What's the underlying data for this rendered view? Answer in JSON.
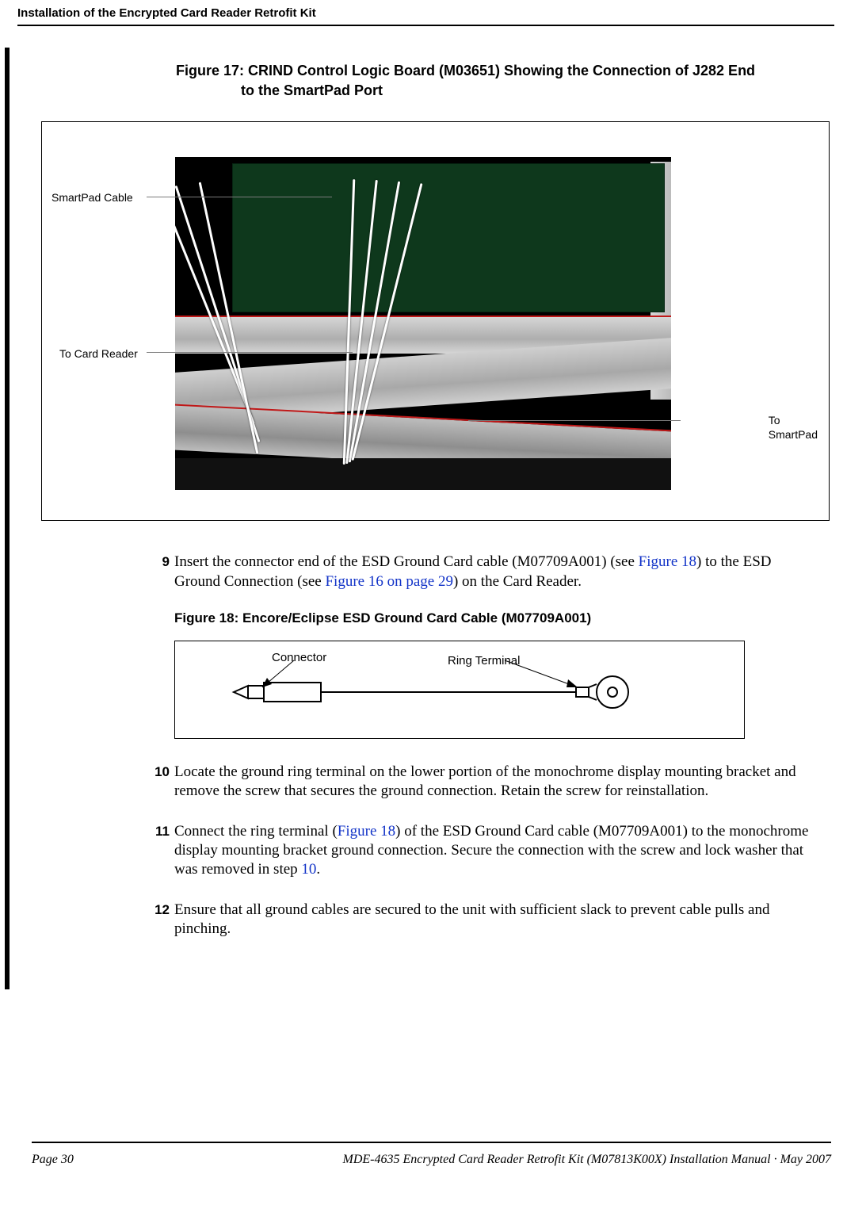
{
  "header": {
    "section_title": "Installation of the Encrypted Card Reader Retrofit Kit"
  },
  "figure17": {
    "caption_line1": "Figure 17: CRIND Control Logic Board (M03651) Showing the Connection of J282 End",
    "caption_line2": "to the SmartPad Port",
    "label_smartpad_cable": "SmartPad Cable",
    "label_to_card_reader": "To Card Reader",
    "label_to_smartpad_1": "To",
    "label_to_smartpad_2": "SmartPad"
  },
  "steps": {
    "s9": {
      "num": "9",
      "pre": "Insert the connector end of the ESD Ground Card cable (M07709A001) (see ",
      "link9a": "Figure 18",
      "mid": ") to the ESD Ground Connection (see ",
      "link9b": "Figure 16 on page 29",
      "post": ") on the Card Reader."
    },
    "s10": {
      "num": "10",
      "text": "Locate the ground ring terminal on the lower portion of the monochrome display mounting bracket and remove the screw that secures the ground connection. Retain the screw for reinstallation."
    },
    "s11": {
      "num": "11",
      "pre": "Connect the ring terminal (",
      "link11a": "Figure 18",
      "mid": ") of the ESD Ground Card cable (M07709A001) to the monochrome display mounting bracket ground connection. Secure the connection with the screw and lock washer that was removed in step ",
      "link11b": "10",
      "post": "."
    },
    "s12": {
      "num": "12",
      "text": "Ensure that all ground cables are secured to the unit with sufficient slack to prevent cable pulls and pinching."
    }
  },
  "figure18": {
    "caption": "Figure 18: Encore/Eclipse ESD Ground Card Cable (M07709A001)",
    "label_connector": "Connector",
    "label_ring_terminal": "Ring Terminal"
  },
  "footer": {
    "page": "Page 30",
    "doc": "MDE-4635 Encrypted Card Reader Retrofit Kit (M07813K00X) Installation Manual · May 2007"
  }
}
